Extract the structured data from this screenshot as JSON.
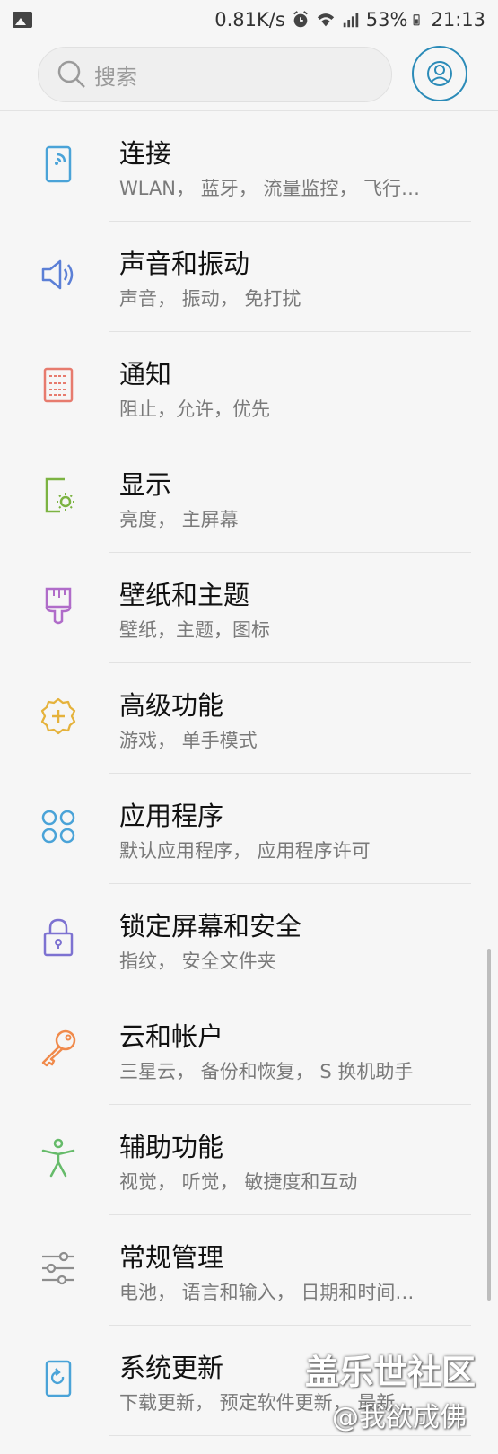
{
  "status_bar": {
    "speed": "0.81K/s",
    "battery": "53%",
    "time": "21:13"
  },
  "search": {
    "placeholder": "搜索"
  },
  "items": [
    {
      "title": "连接",
      "subtitle": "WLAN， 蓝牙， 流量监控， 飞行…",
      "icon": "wifi-tablet-icon",
      "color": "#4aa3d8"
    },
    {
      "title": "声音和振动",
      "subtitle": "声音， 振动， 免打扰",
      "icon": "speaker-icon",
      "color": "#5b7fd6"
    },
    {
      "title": "通知",
      "subtitle": "阻止，允许，优先",
      "icon": "notification-icon",
      "color": "#e77b6e"
    },
    {
      "title": "显示",
      "subtitle": "亮度， 主屏幕",
      "icon": "brightness-icon",
      "color": "#7cb342"
    },
    {
      "title": "壁纸和主题",
      "subtitle": "壁纸，主题，图标",
      "icon": "paintbrush-icon",
      "color": "#b06cc9"
    },
    {
      "title": "高级功能",
      "subtitle": "游戏， 单手模式",
      "icon": "gear-plus-icon",
      "color": "#e5b23b"
    },
    {
      "title": "应用程序",
      "subtitle": "默认应用程序， 应用程序许可",
      "icon": "apps-grid-icon",
      "color": "#4aa3d8"
    },
    {
      "title": "锁定屏幕和安全",
      "subtitle": "指纹， 安全文件夹",
      "icon": "lock-icon",
      "color": "#7d72d1"
    },
    {
      "title": "云和帐户",
      "subtitle": "三星云， 备份和恢复， S 换机助手",
      "icon": "key-icon",
      "color": "#f08a4b"
    },
    {
      "title": "辅助功能",
      "subtitle": "视觉， 听觉， 敏捷度和互动",
      "icon": "accessibility-icon",
      "color": "#66bb6a"
    },
    {
      "title": "常规管理",
      "subtitle": "电池， 语言和输入， 日期和时间…",
      "icon": "sliders-icon",
      "color": "#8d8d8d"
    },
    {
      "title": "系统更新",
      "subtitle": "下载更新， 预定软件更新， 最新…",
      "icon": "update-icon",
      "color": "#4aa3d8"
    }
  ],
  "watermark": {
    "line1": "盖乐世社区",
    "line2": "@我欲成佛"
  }
}
